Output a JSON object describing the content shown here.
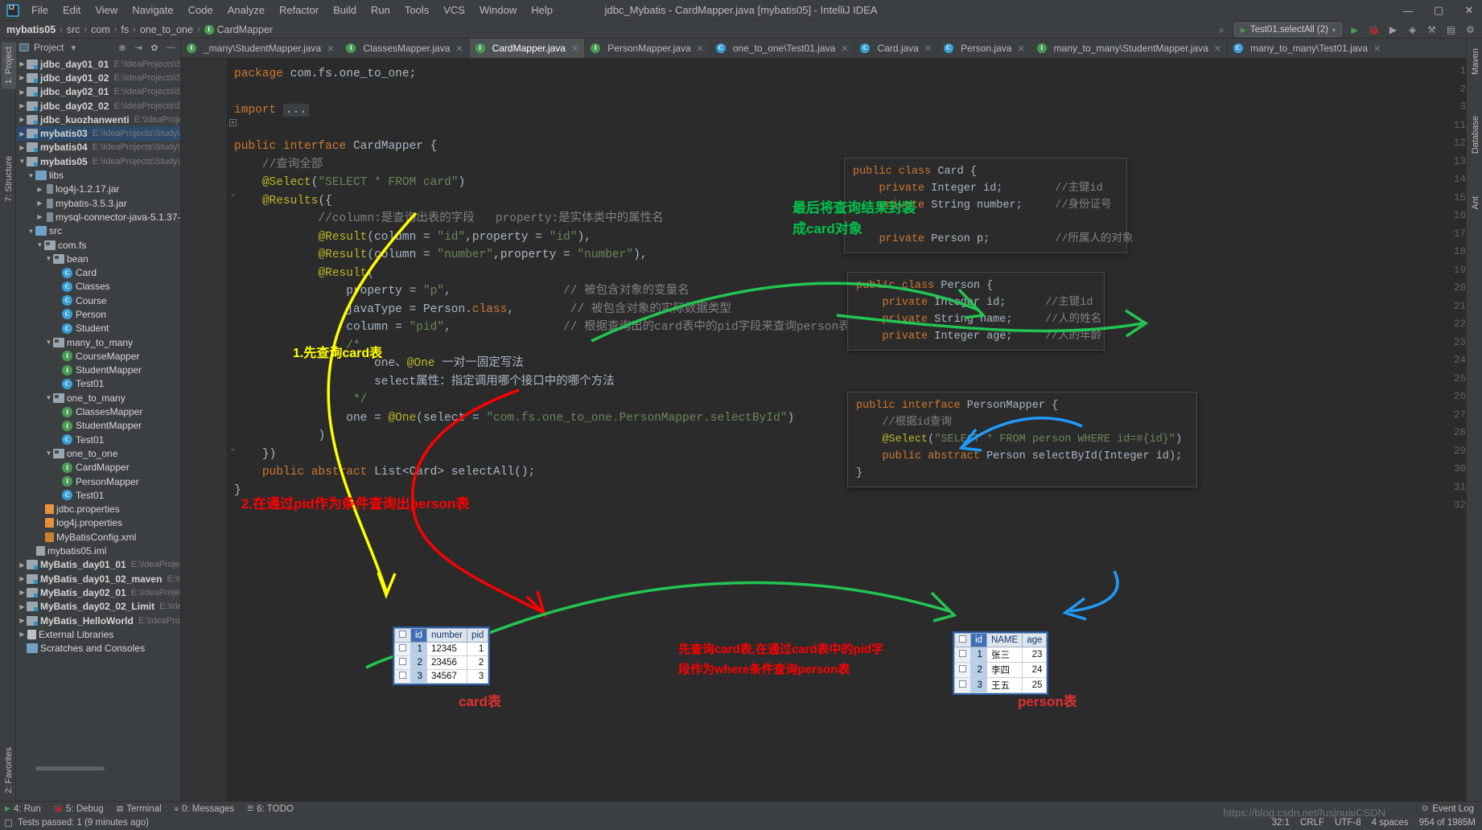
{
  "window": {
    "title": "jdbc_Mybatis - CardMapper.java [mybatis05] - IntelliJ IDEA",
    "minimize": "—",
    "maximize": "▢",
    "close": "✕"
  },
  "menu": [
    "File",
    "Edit",
    "View",
    "Navigate",
    "Code",
    "Analyze",
    "Refactor",
    "Build",
    "Run",
    "Tools",
    "VCS",
    "Window",
    "Help"
  ],
  "breadcrumb": {
    "items": [
      "mybatis05",
      "src",
      "com",
      "fs",
      "one_to_one",
      "CardMapper"
    ],
    "separator": "›"
  },
  "navbar_right": {
    "run_config": "Test01.selectAll (2)",
    "search_icon": "⌕",
    "run_icon": "▶",
    "debug_icon": "🐞",
    "coverage_icon": "▶",
    "profile_icon": "◈",
    "build_icon": "🔨",
    "layout_icon": "▤",
    "settings_icon": "⚙"
  },
  "left_strip": {
    "project_tab": "1: Project",
    "structure_tab": "7: Structure",
    "favorites_tab": "2: Favorites"
  },
  "right_strip": {
    "maven_tab": "Maven",
    "database_tab": "Database",
    "ant_tab": "Ant"
  },
  "project_panel": {
    "title": "Project",
    "dropdown_icon": "▾",
    "locate_icon": "⊕",
    "collapse_icon": "⇥",
    "settings_icon": "✿",
    "hide_icon": "—",
    "tree": [
      {
        "depth": 0,
        "arrow": "▶",
        "icon": "module",
        "name": "jdbc_day01_01",
        "path": "E:\\IdeaProjects\\Stud",
        "bold": true
      },
      {
        "depth": 0,
        "arrow": "▶",
        "icon": "module",
        "name": "jdbc_day01_02",
        "path": "E:\\IdeaProjects\\Stud",
        "bold": true
      },
      {
        "depth": 0,
        "arrow": "▶",
        "icon": "module",
        "name": "jdbc_day02_01",
        "path": "E:\\IdeaProjects\\Stud",
        "bold": true
      },
      {
        "depth": 0,
        "arrow": "▶",
        "icon": "module",
        "name": "jdbc_day02_02",
        "path": "E:\\IdeaProjects\\Stud",
        "bold": true
      },
      {
        "depth": 0,
        "arrow": "▶",
        "icon": "module",
        "name": "jdbc_kuozhanwenti",
        "path": "E:\\IdeaProject",
        "bold": true
      },
      {
        "depth": 0,
        "arrow": "▶",
        "icon": "module",
        "name": "mybatis03",
        "path": "E:\\IdeaProjects\\Study\\jd",
        "bold": true,
        "selected": true
      },
      {
        "depth": 0,
        "arrow": "▶",
        "icon": "module",
        "name": "mybatis04",
        "path": "E:\\IdeaProjects\\Study\\jd",
        "bold": true
      },
      {
        "depth": 0,
        "arrow": "▼",
        "icon": "module",
        "name": "mybatis05",
        "path": "E:\\IdeaProjects\\Study\\jd",
        "bold": true
      },
      {
        "depth": 1,
        "arrow": "▼",
        "icon": "dir",
        "name": "libs",
        "path": ""
      },
      {
        "depth": 2,
        "arrow": "▶",
        "icon": "jar",
        "name": "log4j-1.2.17.jar",
        "path": ""
      },
      {
        "depth": 2,
        "arrow": "▶",
        "icon": "jar",
        "name": "mybatis-3.5.3.jar",
        "path": ""
      },
      {
        "depth": 2,
        "arrow": "▶",
        "icon": "jar",
        "name": "mysql-connector-java-5.1.37-",
        "path": ""
      },
      {
        "depth": 1,
        "arrow": "▼",
        "icon": "dir",
        "name": "src",
        "path": ""
      },
      {
        "depth": 2,
        "arrow": "▼",
        "icon": "pkg",
        "name": "com.fs",
        "path": ""
      },
      {
        "depth": 3,
        "arrow": "▼",
        "icon": "pkg",
        "name": "bean",
        "path": ""
      },
      {
        "depth": 4,
        "arrow": "",
        "icon": "class",
        "name": "Card",
        "path": ""
      },
      {
        "depth": 4,
        "arrow": "",
        "icon": "class",
        "name": "Classes",
        "path": ""
      },
      {
        "depth": 4,
        "arrow": "",
        "icon": "class",
        "name": "Course",
        "path": ""
      },
      {
        "depth": 4,
        "arrow": "",
        "icon": "class",
        "name": "Person",
        "path": ""
      },
      {
        "depth": 4,
        "arrow": "",
        "icon": "class",
        "name": "Student",
        "path": ""
      },
      {
        "depth": 3,
        "arrow": "▼",
        "icon": "pkg",
        "name": "many_to_many",
        "path": ""
      },
      {
        "depth": 4,
        "arrow": "",
        "icon": "interface",
        "name": "CourseMapper",
        "path": ""
      },
      {
        "depth": 4,
        "arrow": "",
        "icon": "interface",
        "name": "StudentMapper",
        "path": ""
      },
      {
        "depth": 4,
        "arrow": "",
        "icon": "classrun",
        "name": "Test01",
        "path": ""
      },
      {
        "depth": 3,
        "arrow": "▼",
        "icon": "pkg",
        "name": "one_to_many",
        "path": ""
      },
      {
        "depth": 4,
        "arrow": "",
        "icon": "interface",
        "name": "ClassesMapper",
        "path": ""
      },
      {
        "depth": 4,
        "arrow": "",
        "icon": "interface",
        "name": "StudentMapper",
        "path": ""
      },
      {
        "depth": 4,
        "arrow": "",
        "icon": "classrun",
        "name": "Test01",
        "path": ""
      },
      {
        "depth": 3,
        "arrow": "▼",
        "icon": "pkg",
        "name": "one_to_one",
        "path": ""
      },
      {
        "depth": 4,
        "arrow": "",
        "icon": "interface",
        "name": "CardMapper",
        "path": ""
      },
      {
        "depth": 4,
        "arrow": "",
        "icon": "interface",
        "name": "PersonMapper",
        "path": ""
      },
      {
        "depth": 4,
        "arrow": "",
        "icon": "classrun",
        "name": "Test01",
        "path": ""
      },
      {
        "depth": 2,
        "arrow": "",
        "icon": "prop",
        "name": "jdbc.properties",
        "path": ""
      },
      {
        "depth": 2,
        "arrow": "",
        "icon": "prop",
        "name": "log4j.properties",
        "path": ""
      },
      {
        "depth": 2,
        "arrow": "",
        "icon": "xml",
        "name": "MyBatisConfig.xml",
        "path": ""
      },
      {
        "depth": 1,
        "arrow": "",
        "icon": "iml",
        "name": "mybatis05.iml",
        "path": ""
      },
      {
        "depth": 0,
        "arrow": "▶",
        "icon": "module",
        "name": "MyBatis_day01_01",
        "path": "E:\\IdeaProjects\\",
        "bold": true
      },
      {
        "depth": 0,
        "arrow": "▶",
        "icon": "module",
        "name": "MyBatis_day01_02_maven",
        "path": "E:\\IdeaP",
        "bold": true
      },
      {
        "depth": 0,
        "arrow": "▶",
        "icon": "module",
        "name": "MyBatis_day02_01",
        "path": "E:\\IdeaProjects\\",
        "bold": true
      },
      {
        "depth": 0,
        "arrow": "▶",
        "icon": "module",
        "name": "MyBatis_day02_02_Limit",
        "path": "E:\\IdeaPr",
        "bold": true
      },
      {
        "depth": 0,
        "arrow": "▶",
        "icon": "module",
        "name": "MyBatis_HelloWorld",
        "path": "E:\\IdeaProjec",
        "bold": true
      },
      {
        "depth": 0,
        "arrow": "▶",
        "icon": "lib",
        "name": "External Libraries",
        "path": ""
      },
      {
        "depth": 0,
        "arrow": "",
        "icon": "scratch",
        "name": "Scratches and Consoles",
        "path": ""
      }
    ]
  },
  "editor_tabs": [
    {
      "label": "_many\\StudentMapper.java",
      "icon": "interface",
      "active": false
    },
    {
      "label": "ClassesMapper.java",
      "icon": "interface",
      "active": false
    },
    {
      "label": "CardMapper.java",
      "icon": "interface",
      "active": true
    },
    {
      "label": "PersonMapper.java",
      "icon": "interface",
      "active": false
    },
    {
      "label": "one_to_one\\Test01.java",
      "icon": "classrun",
      "active": false
    },
    {
      "label": "Card.java",
      "icon": "class",
      "active": false
    },
    {
      "label": "Person.java",
      "icon": "class",
      "active": false
    },
    {
      "label": "many_to_many\\StudentMapper.java",
      "icon": "interface",
      "active": false
    },
    {
      "label": "many_to_many\\Test01.java",
      "icon": "classrun",
      "active": false
    }
  ],
  "code": {
    "line_numbers": [
      "1",
      "2",
      "3",
      "11",
      "12",
      "13",
      "14",
      "15",
      "16",
      "17",
      "18",
      "19",
      "20",
      "21",
      "22",
      "23",
      "24",
      "25",
      "26",
      "27",
      "28",
      "29",
      "30",
      "31",
      "32"
    ],
    "lines": [
      "package com.fs.one_to_one;",
      "",
      "import ...",
      "",
      "public interface CardMapper {",
      "    //查询全部",
      "    @Select(\"SELECT * FROM card\")",
      "    @Results({",
      "            //column:是查询出表的字段   property:是实体类中的属性名",
      "            @Result(column = \"id\",property = \"id\"),",
      "            @Result(column = \"number\",property = \"number\"),",
      "            @Result(",
      "                property = \"p\",                // 被包含对象的变量名",
      "                javaType = Person.class,        // 被包含对象的实际数据类型",
      "                column = \"pid\",                // 根据查询出的card表中的pid字段来查询person表",
      "                /*",
      "                    one、@One 一对一固定写法",
      "                    select属性：指定调用哪个接口中的哪个方法",
      "                 */",
      "                one = @One(select = \"com.fs.one_to_one.PersonMapper.selectById\")",
      "            )",
      "    })",
      "    public abstract List<Card> selectAll();",
      "}"
    ]
  },
  "overlay_boxes": {
    "card_class": {
      "lines": [
        "public class Card {",
        "    private Integer id;        //主键id",
        "    private String number;     //身份证号",
        "",
        "    private Person p;          //所属人的对象"
      ]
    },
    "person_class": {
      "lines": [
        "public class Person {",
        "    private Integer id;      //主键id",
        "    private String name;     //人的姓名",
        "    private Integer age;     //人的年龄"
      ]
    },
    "person_mapper": {
      "lines": [
        "public interface PersonMapper {",
        "    //根据id查询",
        "    @Select(\"SELECT * FROM person WHERE id=#{id}\")",
        "    public abstract Person selectById(Integer id);",
        "}"
      ]
    }
  },
  "annotations": {
    "green_note": [
      "最后将查询结果封装",
      "成card对象"
    ],
    "yellow_note": "1.先查询card表",
    "red_note": "2.在通过pid作为条件查询出person表",
    "red_note2": [
      "先查询card表,在通过card表中的pid字",
      "段作为where条件查询person表"
    ],
    "colors": {
      "green": "#00c24a",
      "yellow": "#ffff00",
      "red": "#ff0000",
      "blue": "#1e9bff"
    }
  },
  "db_tables": {
    "card": {
      "caption": "card表",
      "headers": [
        "id",
        "number",
        "pid"
      ],
      "rows": [
        [
          "1",
          "12345",
          "1"
        ],
        [
          "2",
          "23456",
          "2"
        ],
        [
          "3",
          "34567",
          "3"
        ]
      ]
    },
    "person": {
      "caption": "person表",
      "headers": [
        "id",
        "NAME",
        "age"
      ],
      "rows": [
        [
          "1",
          "张三",
          "23"
        ],
        [
          "2",
          "李四",
          "24"
        ],
        [
          "3",
          "王五",
          "25"
        ]
      ]
    }
  },
  "bottom_tools": [
    {
      "icon": "▶",
      "label": "4: Run"
    },
    {
      "icon": "🐞",
      "label": "5: Debug"
    },
    {
      "icon": "▤",
      "label": "Terminal"
    },
    {
      "icon": "≡",
      "label": "0: Messages"
    },
    {
      "icon": "☰",
      "label": "6: TODO"
    }
  ],
  "status": {
    "text": "Tests passed: 1 (9 minutes ago)",
    "caret": "32:1",
    "line_sep": "CRLF",
    "encoding": "UTF-8",
    "indent": "4 spaces",
    "memory": "954 of 1985M",
    "event_log": "Event Log",
    "watermark": "https://blog.csdn.net/fusjnuaiCSDN"
  }
}
